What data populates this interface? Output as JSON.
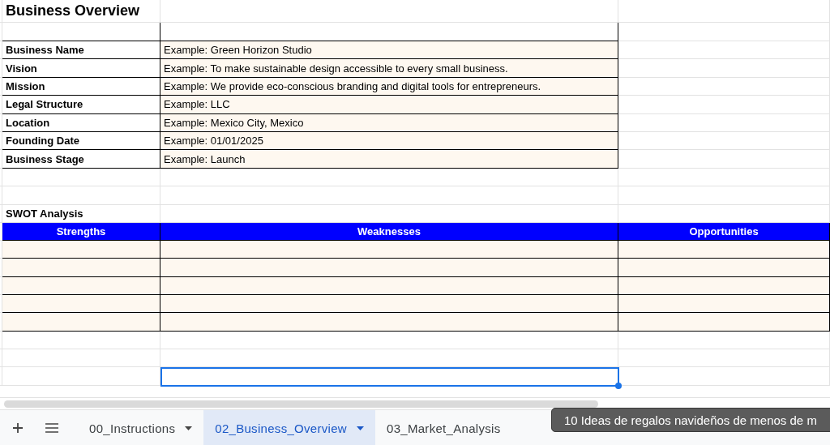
{
  "title": "Business Overview",
  "overview": [
    {
      "label": "Business Name",
      "value": "Example: Green Horizon Studio"
    },
    {
      "label": "Vision",
      "value": "Example: To make sustainable design accessible to every small business."
    },
    {
      "label": "Mission",
      "value": "Example: We provide eco-conscious branding and digital tools for entrepreneurs."
    },
    {
      "label": "Legal Structure",
      "value": "Example: LLC"
    },
    {
      "label": "Location",
      "value": "Example: Mexico City, Mexico"
    },
    {
      "label": "Founding Date",
      "value": "Example: 01/01/2025"
    },
    {
      "label": "Business Stage",
      "value": "Example: Launch"
    }
  ],
  "swot": {
    "title": "SWOT Analysis",
    "columns": [
      "Strengths",
      "Weaknesses",
      "Opportunities"
    ]
  },
  "sheet_tabs": [
    {
      "label": "00_Instructions",
      "selected": false,
      "has_menu": true
    },
    {
      "label": "02_Business_Overview",
      "selected": true,
      "has_menu": true
    },
    {
      "label": "03_Market_Analysis",
      "selected": false,
      "has_menu": false
    }
  ],
  "tooltip": "10 Ideas de regalos navideños de menos de m"
}
